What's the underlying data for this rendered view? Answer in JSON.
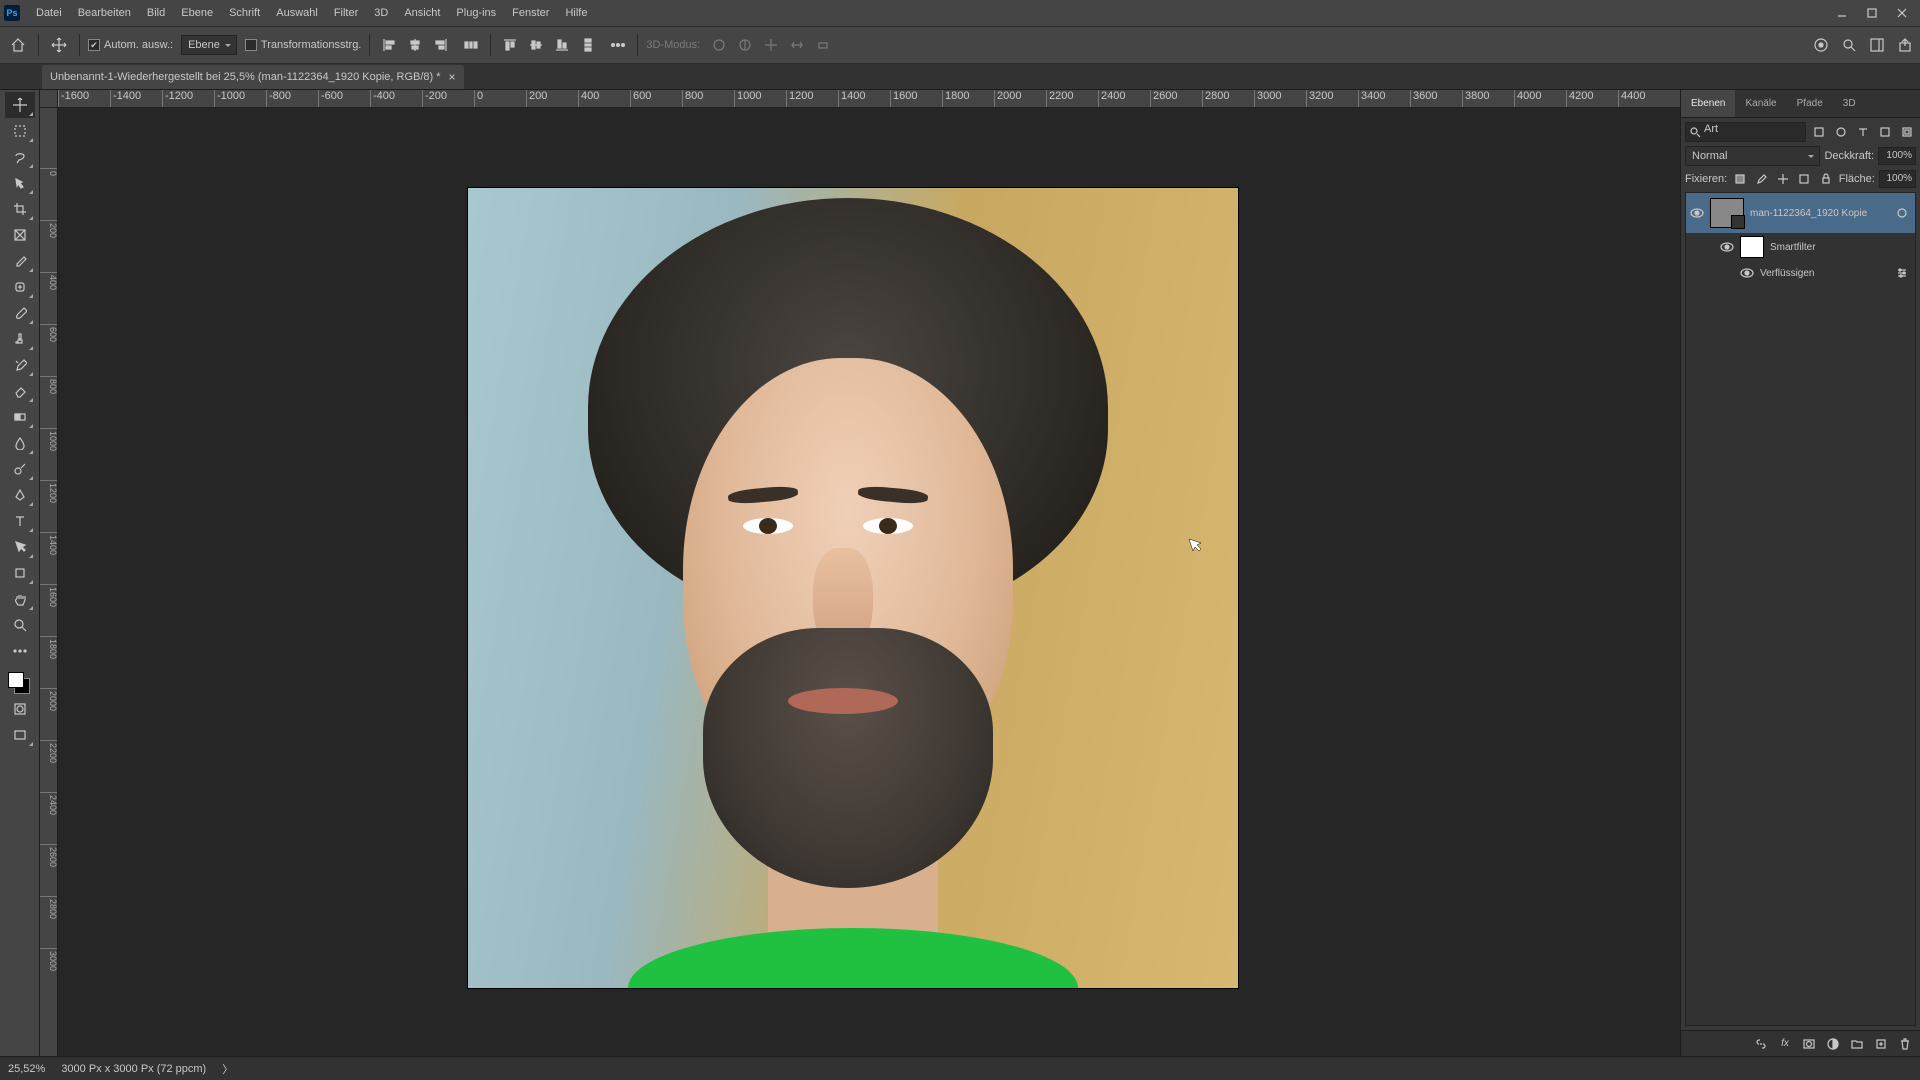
{
  "app": {
    "logo": "Ps"
  },
  "menu": [
    "Datei",
    "Bearbeiten",
    "Bild",
    "Ebene",
    "Schrift",
    "Auswahl",
    "Filter",
    "3D",
    "Ansicht",
    "Plug-ins",
    "Fenster",
    "Hilfe"
  ],
  "options": {
    "auto_select_label": "Autom. ausw.:",
    "target_dd": "Ebene",
    "transform_label": "Transformationsstrg.",
    "mode3d_label": "3D-Modus:"
  },
  "doc_tab": {
    "title": "Unbenannt-1-Wiederhergestellt bei 25,5% (man-1122364_1920 Kopie, RGB/8) *"
  },
  "ruler_h": [
    "-1600",
    "-1400",
    "-1200",
    "-1000",
    "-800",
    "-600",
    "-400",
    "-200",
    "0",
    "200",
    "400",
    "600",
    "800",
    "1000",
    "1200",
    "1400",
    "1600",
    "1800",
    "2000",
    "2200",
    "2400",
    "2600",
    "2800",
    "3000",
    "3200",
    "3400",
    "3600",
    "3800",
    "4000",
    "4200",
    "4400"
  ],
  "ruler_v": [
    "0",
    "200",
    "400",
    "600",
    "800",
    "1000",
    "1200",
    "1400",
    "1600",
    "1800",
    "2000",
    "2200",
    "2400",
    "2600",
    "2800",
    "3000"
  ],
  "panels": {
    "tabs": [
      "Ebenen",
      "Kanäle",
      "Pfade",
      "3D"
    ],
    "search_placeholder": "Art",
    "blend_mode": "Normal",
    "opacity_label": "Deckkraft:",
    "opacity_value": "100%",
    "lock_label": "Fixieren:",
    "fill_label": "Fläche:",
    "fill_value": "100%",
    "layer_name": "man-1122364_1920 Kopie",
    "smartfilter_label": "Smartfilter",
    "liquify_label": "Verflüssigen"
  },
  "status": {
    "zoom": "25,52%",
    "doc_info": "3000 Px x 3000 Px (72 ppcm)",
    "arrow": "〉"
  }
}
